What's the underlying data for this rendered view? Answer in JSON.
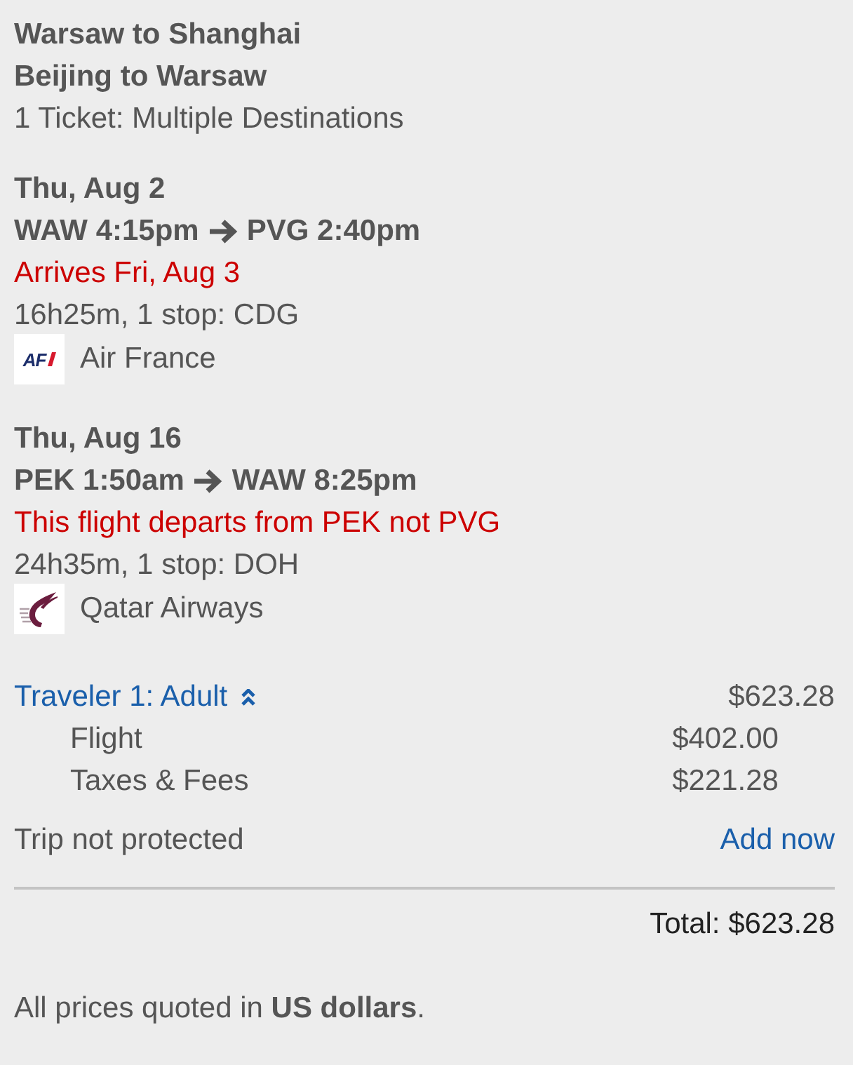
{
  "header": {
    "lines": [
      "Warsaw to Shanghai",
      "Beijing to Warsaw"
    ],
    "subtitle": "1 Ticket: Multiple Destinations"
  },
  "flights": [
    {
      "date": "Thu, Aug 2",
      "depart": "WAW 4:15pm",
      "arrive": "PVG 2:40pm",
      "notice": "Arrives Fri, Aug 3",
      "duration": "16h25m, 1 stop: CDG",
      "airline": {
        "kind": "air-france",
        "logo_text": "AF",
        "name": "Air France"
      }
    },
    {
      "date": "Thu, Aug 16",
      "depart": "PEK 1:50am",
      "arrive": "WAW 8:25pm",
      "notice": "This flight departs from PEK not PVG",
      "duration": "24h35m, 1 stop: DOH",
      "airline": {
        "kind": "qatar",
        "name": "Qatar Airways"
      }
    }
  ],
  "traveler": {
    "label": "Traveler 1: Adult",
    "expanded": true,
    "amount": "$623.28",
    "breakdown": [
      {
        "label": "Flight",
        "amount": "$402.00"
      },
      {
        "label": "Taxes & Fees",
        "amount": "$221.28"
      }
    ]
  },
  "protection": {
    "status": "Trip not protected",
    "link": "Add now"
  },
  "total": "Total: $623.28",
  "footnote": "All prices quoted in **US dollars**."
}
